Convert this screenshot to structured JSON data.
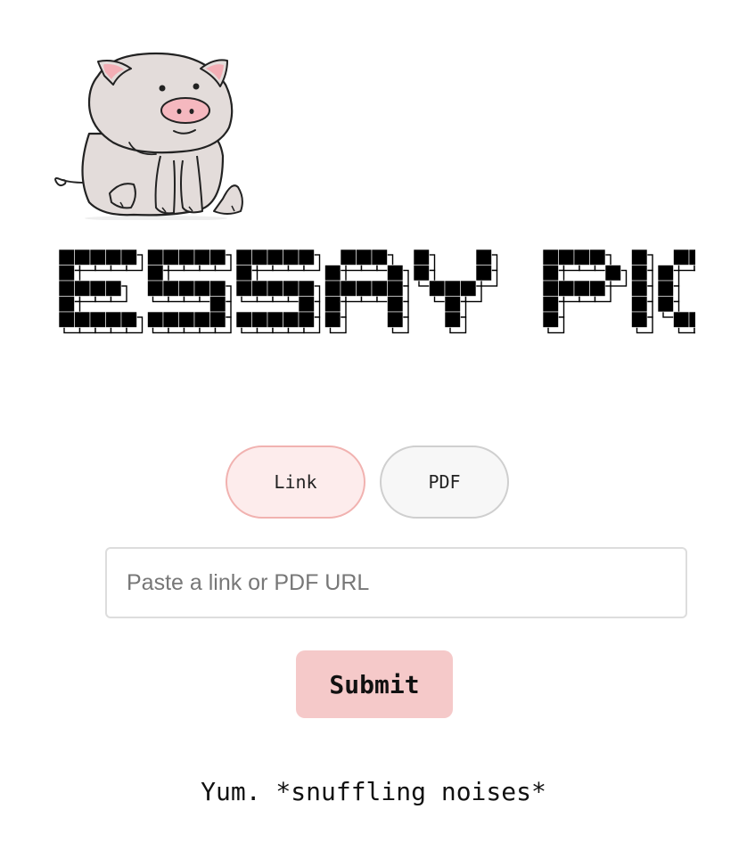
{
  "app": {
    "title": "ESSAY PIG",
    "tagline": "Yum. *snuffling noises*"
  },
  "mode_tabs": [
    {
      "label": "Link",
      "selected": true
    },
    {
      "label": "PDF",
      "selected": false
    }
  ],
  "url_input": {
    "placeholder": "Paste a link or PDF URL",
    "value": ""
  },
  "submit": {
    "label": "Submit"
  },
  "colors": {
    "accent_pink": "#f5c9c9",
    "selected_tab_bg": "#fdecec",
    "selected_tab_border": "#f1b2b0",
    "pig_body": "#e3dcda",
    "pig_snout": "#f5b8bf"
  },
  "icons": {
    "mascot": "pig-mascot-icon"
  }
}
